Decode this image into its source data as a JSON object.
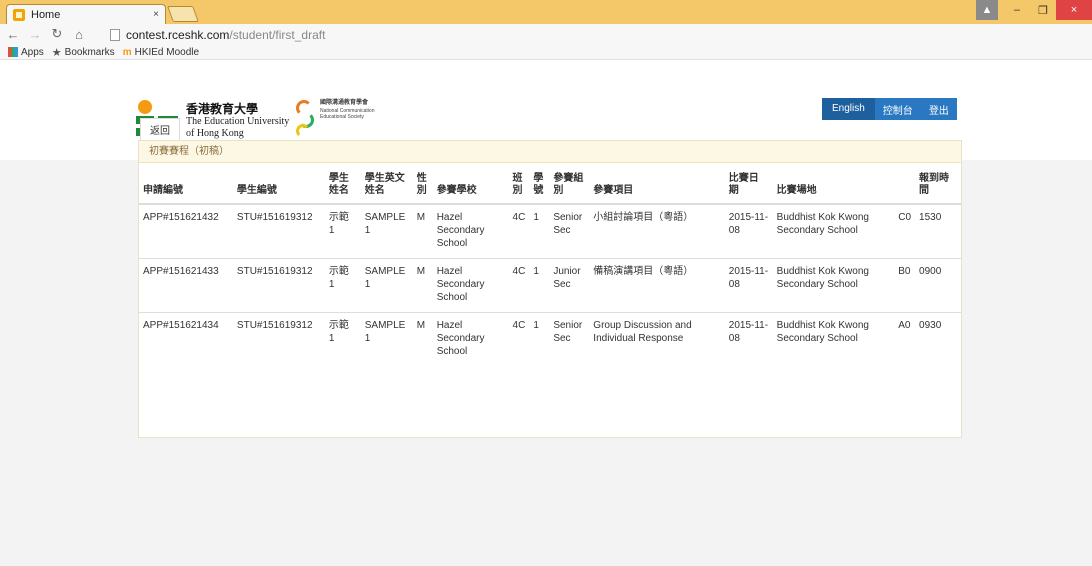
{
  "browser": {
    "tab_title": "Home",
    "tab_close": "×",
    "url_host": "contest.rceshk.com",
    "url_path": "/student/first_draft",
    "bookmarks": [
      {
        "label": "Apps",
        "icon": "apps-grid-icon"
      },
      {
        "label": "Bookmarks",
        "icon": "star-icon"
      },
      {
        "label": "HKIEd Moodle",
        "icon": "moodle-icon"
      }
    ],
    "window_controls": {
      "minimize": "–",
      "restore": "❐",
      "close": "×"
    }
  },
  "header": {
    "logo_zh": "香港教育大學",
    "logo_en_line1": "The Education University",
    "logo_en_line2": "of Hong Kong",
    "society_zh": "國際溝通教育學會",
    "society_en_line1": "National Communication",
    "society_en_line2": "Educational Society",
    "nav": {
      "english": "English",
      "console": "控制台",
      "logout": "登出"
    },
    "accent": "#2b78c2"
  },
  "main": {
    "back_label": "返回",
    "panel_title": "初賽賽程（初稿）",
    "columns": [
      "申請編號",
      "學生編號",
      "學生姓名",
      "學生英文姓名",
      "性別",
      "參賽學校",
      "班別",
      "學號",
      "參賽組別",
      "參賽項目",
      "比賽日期",
      "比賽場地",
      "",
      "報到時間"
    ],
    "rows": [
      [
        "APP#151621432",
        "STU#151619312",
        "示範 1",
        "SAMPLE 1",
        "M",
        "Hazel Secondary School",
        "4C",
        "1",
        "Senior Sec",
        "小組討論項目（粵語）",
        "2015-11-08",
        "Buddhist Kok Kwong Secondary School",
        "C0",
        "1530"
      ],
      [
        "APP#151621433",
        "STU#151619312",
        "示範 1",
        "SAMPLE 1",
        "M",
        "Hazel Secondary School",
        "4C",
        "1",
        "Junior Sec",
        "備稿演講項目（粵語）",
        "2015-11-08",
        "Buddhist Kok Kwong Secondary School",
        "B0",
        "0900"
      ],
      [
        "APP#151621434",
        "STU#151619312",
        "示範 1",
        "SAMPLE 1",
        "M",
        "Hazel Secondary School",
        "4C",
        "1",
        "Senior Sec",
        "Group Discussion and Individual Response",
        "2015-11-08",
        "Buddhist Kok Kwong Secondary School",
        "A0",
        "0930"
      ]
    ]
  }
}
